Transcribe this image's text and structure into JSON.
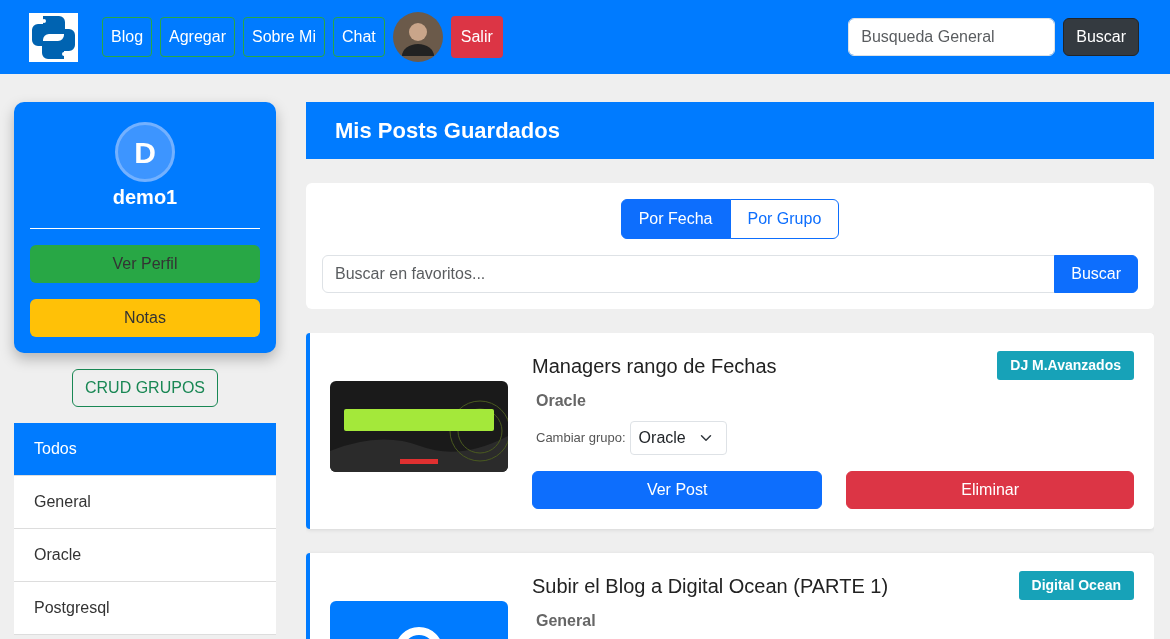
{
  "navbar": {
    "links": [
      "Blog",
      "Agregar",
      "Sobre Mi",
      "Chat"
    ],
    "logout": "Salir",
    "search": {
      "placeholder": "Busqueda General",
      "button": "Buscar"
    }
  },
  "profile": {
    "initial": "D",
    "username": "demo1",
    "buttons": [
      "Ver Perfil",
      "Notas"
    ]
  },
  "crud_button": "CRUD GRUPOS",
  "groups": [
    {
      "label": "Todos",
      "selected": true
    },
    {
      "label": "General",
      "selected": false
    },
    {
      "label": "Oracle",
      "selected": false
    },
    {
      "label": "Postgresql",
      "selected": false
    }
  ],
  "header": "Mis Posts Guardados",
  "sort_tabs": [
    {
      "label": "Por Fecha",
      "selected": true
    },
    {
      "label": "Por Grupo",
      "selected": false
    }
  ],
  "fav_search": {
    "placeholder": "Buscar en favoritos...",
    "button": "Buscar"
  },
  "posts": [
    {
      "title": "Managers rango de Fechas",
      "badge": "DJ M.Avanzados",
      "color": "#17a2b8",
      "group": "Oracle",
      "change_label": "Cambiar grupo:",
      "select_value": "Oracle",
      "view_button": "Ver Post",
      "delete_button": "Eliminar",
      "kind": "picture"
    },
    {
      "title": "Subir el Blog a Digital Ocean (PARTE 1)",
      "badge": "Digital Ocean",
      "color": "#17a2b8",
      "group": "General",
      "kind": "picture"
    }
  ]
}
